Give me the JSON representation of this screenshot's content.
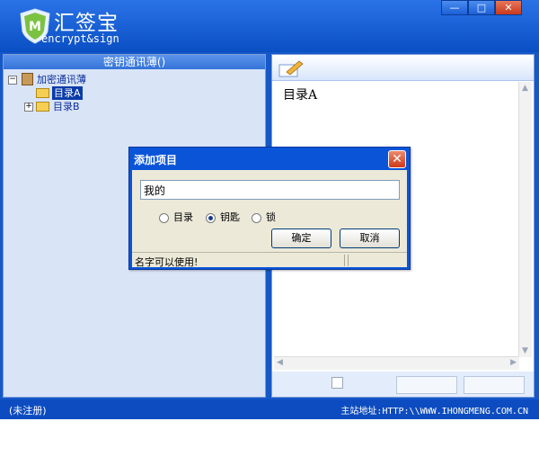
{
  "app": {
    "name": "汇签宝",
    "subtitle": "encrypt&sign",
    "window_controls": {
      "minimize": "—",
      "maximize": "□",
      "close": "✕"
    }
  },
  "left_panel": {
    "title": "密钥通讯薄()",
    "tree": [
      {
        "label": "加密通讯薄",
        "expander": "−",
        "icon": "address-book-icon"
      },
      {
        "label": "目录A",
        "icon": "folder-icon",
        "selected": true
      },
      {
        "label": "目录B",
        "expander": "+",
        "icon": "folder-icon"
      }
    ]
  },
  "right_panel": {
    "content_title": "目录A"
  },
  "status_bar": {
    "left": "(未注册)",
    "right": "主站地址:HTTP:\\\\WWW.IHONGMENG.COM.CN"
  },
  "dialog": {
    "title": "添加项目",
    "close_label": "✕",
    "name_value": "我的",
    "radio_options": [
      {
        "label": "目录",
        "checked": false
      },
      {
        "label": "钥匙",
        "checked": true
      },
      {
        "label": "锁",
        "checked": false
      }
    ],
    "ok_label": "确定",
    "cancel_label": "取消",
    "status_text": "名字可以使用!"
  },
  "colors": {
    "frame_blue": "#1558c8",
    "dialog_blue": "#0a54d8",
    "panel_bg": "#d9e4f7",
    "selection": "#0a3ba8"
  }
}
